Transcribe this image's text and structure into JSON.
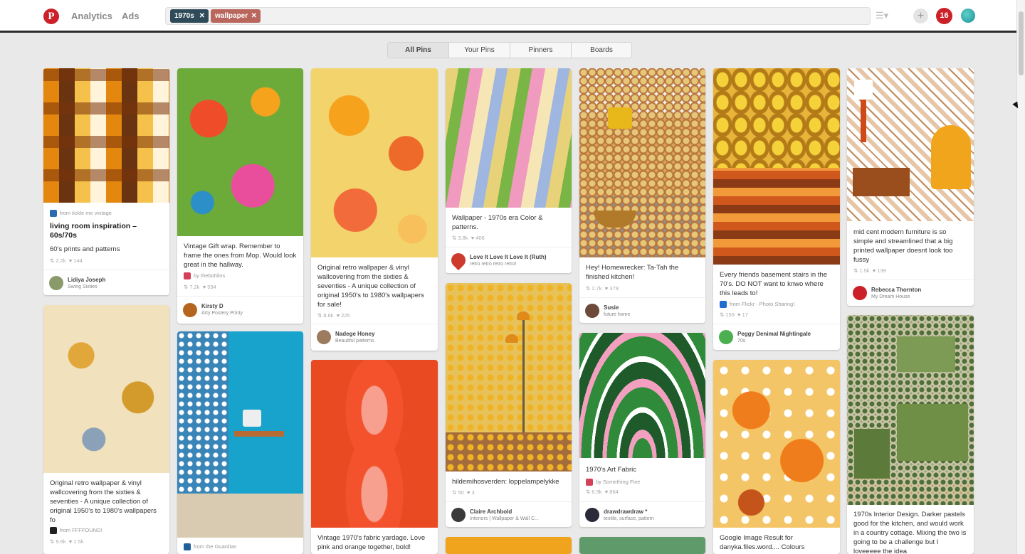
{
  "header": {
    "logo": "P",
    "nav": [
      "Analytics",
      "Ads"
    ],
    "search_tokens": [
      {
        "label": "1970s",
        "color": "#2f4b59"
      },
      {
        "label": "wallpaper",
        "color": "#b9665c"
      }
    ],
    "notifications": "16"
  },
  "tabs": [
    "All Pins",
    "Your Pins",
    "Pinners",
    "Boards"
  ],
  "pins": {
    "p1": {
      "src": "from tickle me vintage",
      "title": "living room inspiration – 60s/70s",
      "desc": "60's prints and patterns",
      "repins": "2.2k",
      "likes": "144",
      "user": "Lidiya Joseph",
      "board": "Swing Sixties"
    },
    "p2": {
      "desc": "Vintage Gift wrap. Remember to frame the ones from Mop. Would look great in the hallway.",
      "src": "by thebohlins",
      "repins": "7.2k",
      "likes": "594",
      "user": "Kirsty D",
      "board": "Arty Postery Printy"
    },
    "p3": {
      "desc": "Original retro wallpaper & vinyl wallcovering from the sixties & seventies - A unique collection of original 1950's to 1980's wallpapers for sale!",
      "repins": "8.6k",
      "likes": "225",
      "user": "Nadege Honey",
      "board": "Beautiful patterns"
    },
    "p4": {
      "desc": "Wallpaper - 1970s era Color & patterns.",
      "repins": "3.8k",
      "likes": "406",
      "user": "Love It Love It Love It (Ruth)",
      "board": "retro retro retro retro!"
    },
    "p5": {
      "desc": "Hey! Homewrecker: Ta-Tah the finished kitchen!",
      "repins": "2.7k",
      "likes": "379",
      "user": "Susie",
      "board": "future home"
    },
    "p6": {
      "desc": "Every friends basement stairs in the 70's. DO NOT want to knwo where this leads to!",
      "src": "from Flickr - Photo Sharing!",
      "repins": "159",
      "likes": "17",
      "user": "Peggy Denimal Nightingale",
      "board": "70s"
    },
    "p7": {
      "desc": "mid cent modern furniture is so simple and streamlined that a big printed wallpaper doesnt look too fussy",
      "repins": "1.5k",
      "likes": "139",
      "user": "Rebecca Thornton",
      "board": "My Dream House"
    },
    "p8": {
      "desc": "Original retro wallpaper & vinyl wallcovering from the sixties & seventies - A unique collection of original 1950's to 1980's wallpapers fo",
      "src": "from FFFFOUND!",
      "repins": "9.6k",
      "likes": "1.5k"
    },
    "p9": {
      "src": "from the Guardian"
    },
    "p11": {
      "desc": "hildemihosverden: loppelampelykke",
      "repins": "50",
      "likes": "3",
      "user": "Claire Archbold",
      "board": "Interiors | Wallpaper & Wall C..."
    },
    "p12": {
      "desc": "1970's Art Fabric",
      "src": "by Something Fine",
      "repins": "6.9k",
      "likes": "864",
      "user": "drawdrawdraw *",
      "board": "textile, surface, pattern"
    },
    "p10": {
      "desc": "Vintage 1970's fabric yardage. Love pink and orange together, bold!"
    },
    "p13": {
      "desc": "Google Image Result for danyka.files.word.... Colours"
    },
    "p14": {
      "desc": "1970s Interior Design. Darker pastels good for the kitchen, and would work in a country cottage. Mixing the two is going to be a challenge but I loveeeee the idea"
    }
  }
}
